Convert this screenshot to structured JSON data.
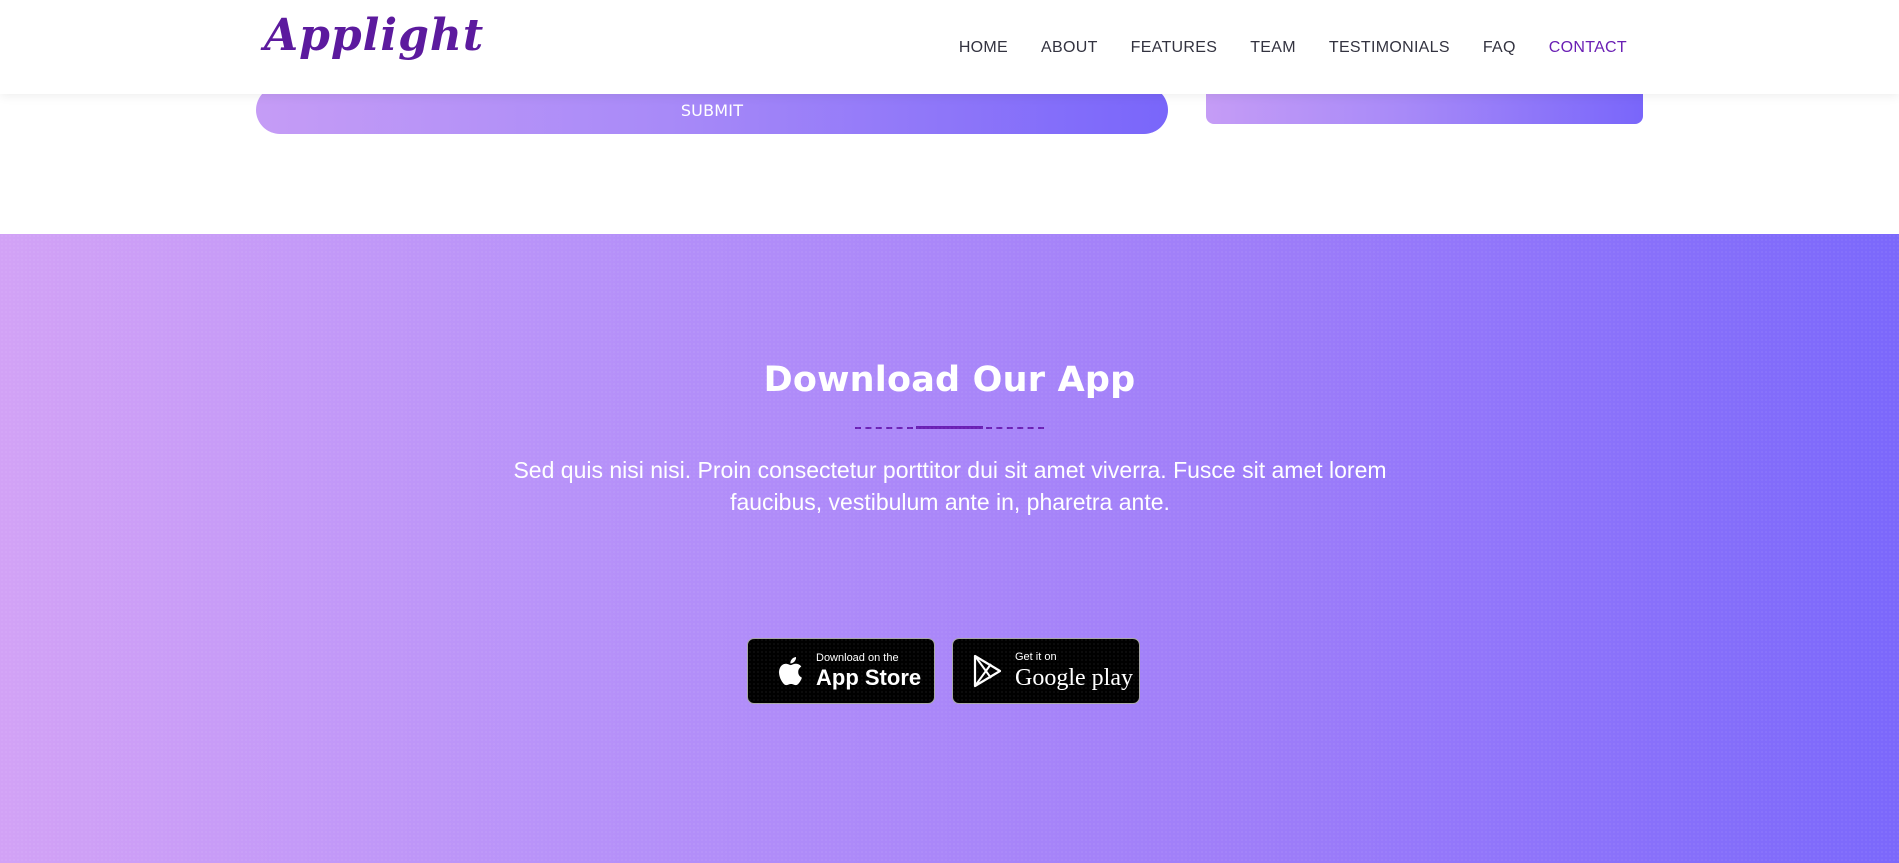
{
  "header": {
    "logo_text": "Applight",
    "nav": [
      {
        "label": "HOME"
      },
      {
        "label": "ABOUT"
      },
      {
        "label": "FEATURES"
      },
      {
        "label": "TEAM"
      },
      {
        "label": "TESTIMONIALS"
      },
      {
        "label": "FAQ"
      },
      {
        "label": "CONTACT",
        "active": true
      }
    ]
  },
  "contact_form": {
    "submit_label": "SUBMIT"
  },
  "download": {
    "title": "Download Our App",
    "description": "Sed quis nisi nisi. Proin consectetur porttitor dui sit amet viverra. Fusce sit amet lorem faucibus, vestibulum ante in, pharetra ante.",
    "app_store": {
      "small": "Download on the",
      "big": "App Store",
      "icon": "apple-icon"
    },
    "google_play": {
      "small": "Get it on",
      "big": "Google play",
      "icon": "google-play-icon"
    }
  },
  "colors": {
    "brand_purple": "#6a1fb4",
    "gradient_start": "#d2a2f6",
    "gradient_end": "#7b68fb",
    "nav_text": "#333340"
  }
}
